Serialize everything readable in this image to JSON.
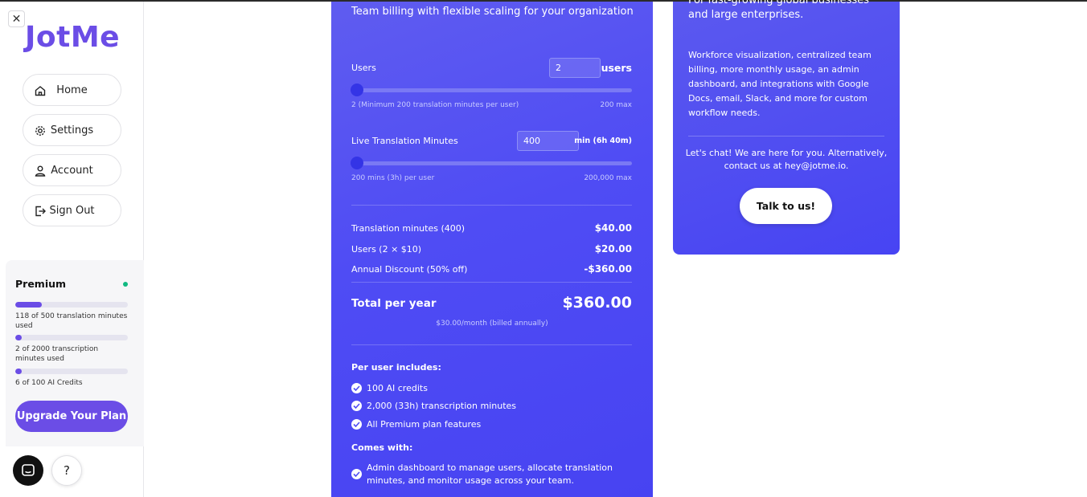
{
  "app": {
    "logo": "JotMe",
    "close_symbol": "✕"
  },
  "sidebar": {
    "items": [
      {
        "label": "Home",
        "icon": "home-icon"
      },
      {
        "label": "Settings",
        "icon": "gear-icon"
      },
      {
        "label": "Account",
        "icon": "user-icon"
      },
      {
        "label": "Sign Out",
        "icon": "sign-out-icon"
      }
    ],
    "usage": {
      "plan": "Premium",
      "status_color": "#10b981",
      "translation": {
        "label": "118 of 500 translation minutes used",
        "fraction": 0.236
      },
      "transcription": {
        "label": "2 of 2000 transcription minutes used",
        "fraction": 0.001
      },
      "ai_credits": {
        "label": "6 of 100 AI Credits",
        "fraction": 0.06
      },
      "upgrade_label": "Upgrade Your Plan"
    },
    "help_label": "?"
  },
  "pricing": {
    "subtitle": "Team billing with flexible scaling for your organization",
    "users": {
      "label": "Users",
      "value": "2",
      "unit": "users",
      "min_note": "2 (Minimum 200 translation minutes per user)",
      "max_note": "200 max",
      "slider_fraction": 0.0
    },
    "minutes": {
      "label": "Live Translation Minutes",
      "value": "400",
      "unit": "min (6h 40m)",
      "min_note": "200 mins (3h) per user",
      "max_note": "200,000 max",
      "slider_fraction": 0.0
    },
    "lines": [
      {
        "label": "Translation minutes (400)",
        "amount": "$40.00"
      },
      {
        "label": "Users (2 × $10)",
        "amount": "$20.00"
      },
      {
        "label": "Annual Discount (50% off)",
        "amount": "-$360.00"
      }
    ],
    "total": {
      "label": "Total per year",
      "amount": "$360.00",
      "note": "$30.00/month (billed annually)"
    },
    "includes_title": "Per user includes:",
    "includes": [
      "100 AI credits",
      "2,000 (33h) transcription minutes",
      "All Premium plan features"
    ],
    "comes_title": "Comes with:",
    "comes": [
      "Admin dashboard to manage users, allocate translation minutes, and monitor usage across your team."
    ]
  },
  "enterprise": {
    "headline": "For fast-growing global businesses and large enterprises.",
    "description": "Workforce visualization, centralized team billing, more monthly usage, an admin dashboard, and integrations with Google Docs, email, Slack, and more for custom workflow needs.",
    "contact": "Let's chat! We are here for you. Alternatively, contact us at hey@jotme.io.",
    "cta": "Talk to us!"
  }
}
